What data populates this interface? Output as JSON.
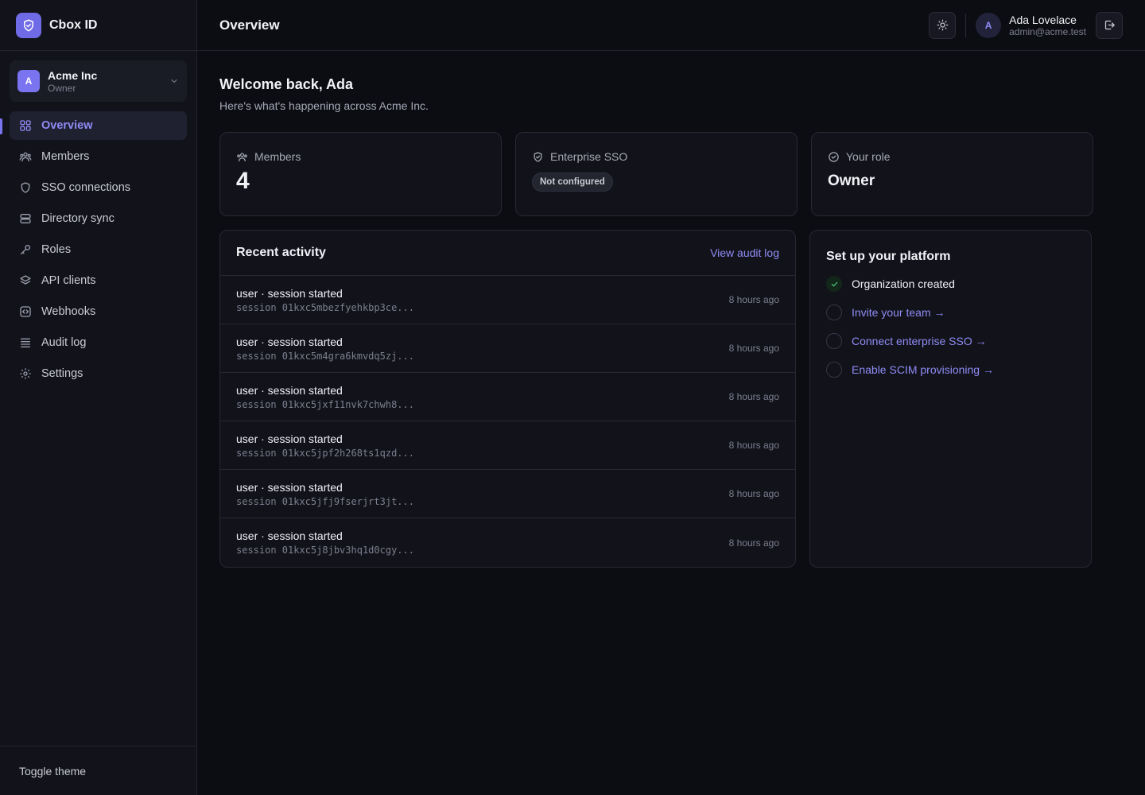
{
  "brand": {
    "name": "Cbox ID",
    "logo_icon": "shield-check-icon",
    "accent": "#6f6ae6"
  },
  "org": {
    "initial": "A",
    "name": "Acme Inc",
    "role": "Owner"
  },
  "nav": {
    "items": [
      {
        "label": "Overview",
        "icon": "grid-icon",
        "active": true
      },
      {
        "label": "Members",
        "icon": "users-icon"
      },
      {
        "label": "SSO connections",
        "icon": "shield-icon"
      },
      {
        "label": "Directory sync",
        "icon": "database-icon"
      },
      {
        "label": "Roles",
        "icon": "key-icon"
      },
      {
        "label": "API clients",
        "icon": "layers-icon"
      },
      {
        "label": "Webhooks",
        "icon": "code-square-icon"
      },
      {
        "label": "Audit log",
        "icon": "list-icon"
      },
      {
        "label": "Settings",
        "icon": "gear-icon"
      }
    ]
  },
  "sidebar_footer": {
    "toggle_theme": "Toggle theme"
  },
  "topbar": {
    "title": "Overview",
    "user": {
      "initial": "A",
      "name": "Ada Lovelace",
      "email": "admin@acme.test"
    }
  },
  "welcome": {
    "title": "Welcome back, Ada",
    "subtitle": "Here's what's happening across Acme Inc."
  },
  "stats": {
    "members": {
      "label": "Members",
      "value": "4"
    },
    "sso": {
      "label": "Enterprise SSO",
      "status": "Not configured"
    },
    "role": {
      "label": "Your role",
      "value": "Owner"
    }
  },
  "activity": {
    "title": "Recent activity",
    "view_link": "View audit log",
    "rows": [
      {
        "title": "user · session started",
        "sub": "session 01kxc5mbezfyehkbp3ce...",
        "time": "8 hours ago"
      },
      {
        "title": "user · session started",
        "sub": "session 01kxc5m4gra6kmvdq5zj...",
        "time": "8 hours ago"
      },
      {
        "title": "user · session started",
        "sub": "session 01kxc5jxf11nvk7chwh8...",
        "time": "8 hours ago"
      },
      {
        "title": "user · session started",
        "sub": "session 01kxc5jpf2h268ts1qzd...",
        "time": "8 hours ago"
      },
      {
        "title": "user · session started",
        "sub": "session 01kxc5jfj9fserjrt3jt...",
        "time": "8 hours ago"
      },
      {
        "title": "user · session started",
        "sub": "session 01kxc5j8jbv3hq1d0cgy...",
        "time": "8 hours ago"
      }
    ]
  },
  "setup": {
    "title": "Set up your platform",
    "steps": [
      {
        "label": "Organization created",
        "done": true
      },
      {
        "label": "Invite your team →",
        "done": false
      },
      {
        "label": "Connect enterprise SSO →",
        "done": false
      },
      {
        "label": "Enable SCIM provisioning →",
        "done": false
      }
    ]
  }
}
